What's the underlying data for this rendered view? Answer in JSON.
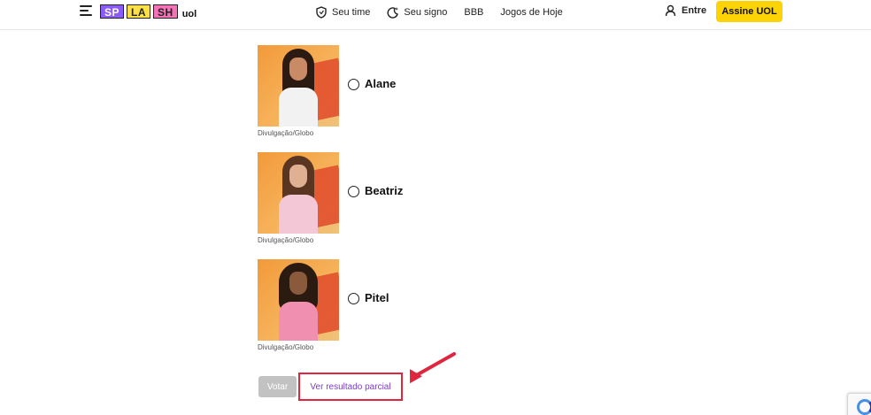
{
  "header": {
    "menu_icon": "hamburger-menu-icon",
    "logo": {
      "blocks": [
        "SP",
        "LA",
        "SH"
      ],
      "suffix": "uol"
    },
    "nav": [
      {
        "label": "Seu time",
        "icon": "shield-icon"
      },
      {
        "label": "Seu signo",
        "icon": "moon-stars-icon"
      },
      {
        "label": "BBB",
        "icon": ""
      },
      {
        "label": "Jogos de Hoje",
        "icon": ""
      }
    ],
    "login_label": "Entre",
    "subscribe_label": "Assine UOL"
  },
  "poll": {
    "options": [
      {
        "name": "Alane",
        "credit": "Divulgação/Globo",
        "selected": false
      },
      {
        "name": "Beatriz",
        "credit": "Divulgação/Globo",
        "selected": false
      },
      {
        "name": "Pitel",
        "credit": "Divulgação/Globo",
        "selected": false
      }
    ],
    "vote_label": "Votar",
    "partial_result_label": "Ver resultado parcial"
  },
  "colors": {
    "subscribe_bg": "#fcd304",
    "link": "#7b3ec9",
    "highlight": "#e0263f",
    "vote_disabled": "#c2c2c2"
  }
}
